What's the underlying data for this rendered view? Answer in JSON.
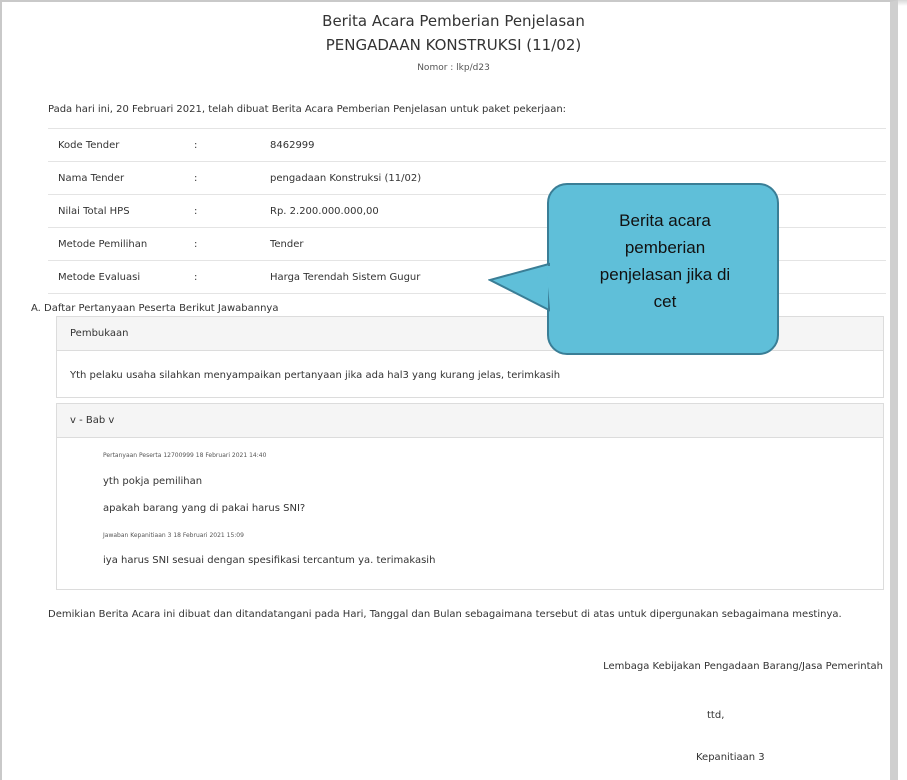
{
  "header": {
    "title": "Berita Acara Pemberian Penjelasan",
    "subtitle": "PENGADAAN KONSTRUKSI (11/02)",
    "nomor": "Nomor : lkp/d23"
  },
  "intro": "Pada hari ini, 20 Februari 2021, telah dibuat Berita Acara Pemberian Penjelasan untuk paket pekerjaan:",
  "info": [
    {
      "label": "Kode Tender",
      "sep": ":",
      "value": "8462999"
    },
    {
      "label": "Nama Tender",
      "sep": ":",
      "value": "pengadaan Konstruksi (11/02)"
    },
    {
      "label": "Nilai Total HPS",
      "sep": ":",
      "value": "Rp. 2.200.000.000,00"
    },
    {
      "label": "Metode Pemilihan",
      "sep": ":",
      "value": "Tender"
    },
    {
      "label": "Metode Evaluasi",
      "sep": ":",
      "value": "Harga Terendah Sistem Gugur"
    }
  ],
  "section_a": "A. Daftar Pertanyaan Peserta Berikut Jawabannya",
  "opening": {
    "heading": "Pembukaan",
    "text": "Yth pelaku usaha silahkan menyampaikan pertanyaan jika ada hal3 yang kurang jelas, terimkasih"
  },
  "bab": {
    "heading": "v - Bab v",
    "question_meta": "Pertanyaan Peserta 12700999 18 Februari 2021 14:40",
    "question_line1": "yth pokja pemilihan",
    "question_line2": "apakah barang yang di pakai harus SNI?",
    "answer_meta": "Jawaban Kepanitiaan 3 18 Februari 2021 15:09",
    "answer": "iya harus SNI sesuai dengan spesifikasi tercantum ya. terimakasih"
  },
  "closing": "Demikian Berita Acara ini dibuat dan ditandatangani pada Hari, Tanggal dan Bulan sebagaimana tersebut di atas untuk dipergunakan sebagaimana mestinya.",
  "signature": {
    "org": "Lembaga Kebijakan Pengadaan Barang/Jasa Pemerintah",
    "ttd": "ttd,",
    "name": "Kepanitiaan 3"
  },
  "callout": {
    "line1": "Berita acara",
    "line2": "pemberian",
    "line3": "penjelasan jika di",
    "line4": "cet"
  },
  "colors": {
    "callout_fill": "#5fbfd9",
    "callout_border": "#3a7e96",
    "panel_header": "#f5f5f5"
  }
}
